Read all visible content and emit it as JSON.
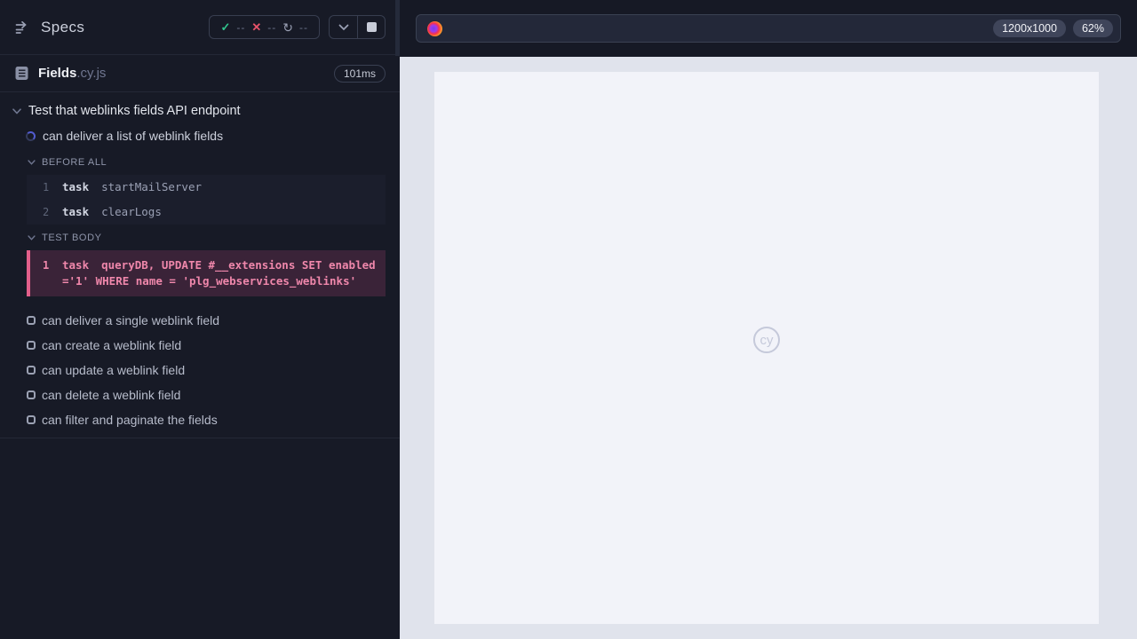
{
  "reporter": {
    "title": "Specs",
    "stats": {
      "passed": "--",
      "failed": "--",
      "running": "--"
    },
    "spec": {
      "name": "Fields",
      "extension": ".cy.js",
      "duration": "101ms"
    },
    "suite_title": "Test that weblinks fields API endpoint",
    "active_test_title": "can deliver a list of weblink fields",
    "before_all": {
      "label": "BEFORE ALL",
      "commands": [
        {
          "number": "1",
          "method": "task",
          "message": "startMailServer"
        },
        {
          "number": "2",
          "method": "task",
          "message": "clearLogs"
        }
      ]
    },
    "test_body": {
      "label": "TEST BODY",
      "commands": [
        {
          "number": "1",
          "method": "task",
          "message": "queryDB, UPDATE #__extensions SET enabled ='1' WHERE name = 'plg_webservices_weblinks'"
        }
      ]
    },
    "pending_tests": [
      "can deliver a single weblink field",
      "can create a weblink field",
      "can update a weblink field",
      "can delete a weblink field",
      "can filter and paginate the fields"
    ]
  },
  "browser": {
    "url_value": "",
    "viewport_size": "1200x1000",
    "viewport_scale": "62%"
  },
  "aut": {
    "watermark": "cy"
  },
  "colors": {
    "pass_green": "#31c48d",
    "fail_red": "#e8536a",
    "highlight_pink": "#e25f8a",
    "sidebar_bg": "#171a26",
    "page_bg": "#f2f3f9"
  }
}
